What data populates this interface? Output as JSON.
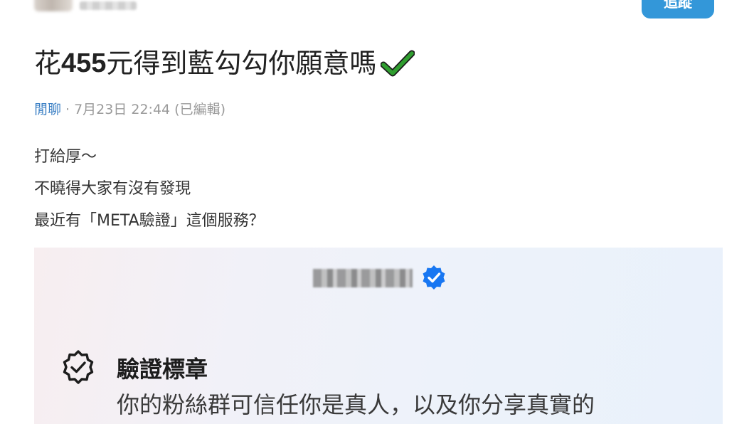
{
  "header": {
    "follow_label": "追蹤"
  },
  "post": {
    "title_prefix": "花",
    "title_number": "455",
    "title_suffix": "元得到藍勾勾你願意嗎",
    "category": "閒聊",
    "separator": "·",
    "timestamp": "7月23日 22:44 (已編輯)",
    "body_lines": [
      "打給厚～",
      "不曉得大家有沒有發現",
      "最近有「META驗證」這個服務？"
    ]
  },
  "card": {
    "feature_title": "驗證標章",
    "feature_desc": "你的粉絲群可信任你是真人，以及你分享真實的"
  },
  "colors": {
    "accent_blue": "#3397d9",
    "verified_blue": "#1877f2",
    "check_green": "#2f9e2f",
    "category_blue": "#3a7fc4"
  },
  "icons": [
    "check-mark-icon",
    "verified-badge-icon",
    "badge-check-icon"
  ]
}
